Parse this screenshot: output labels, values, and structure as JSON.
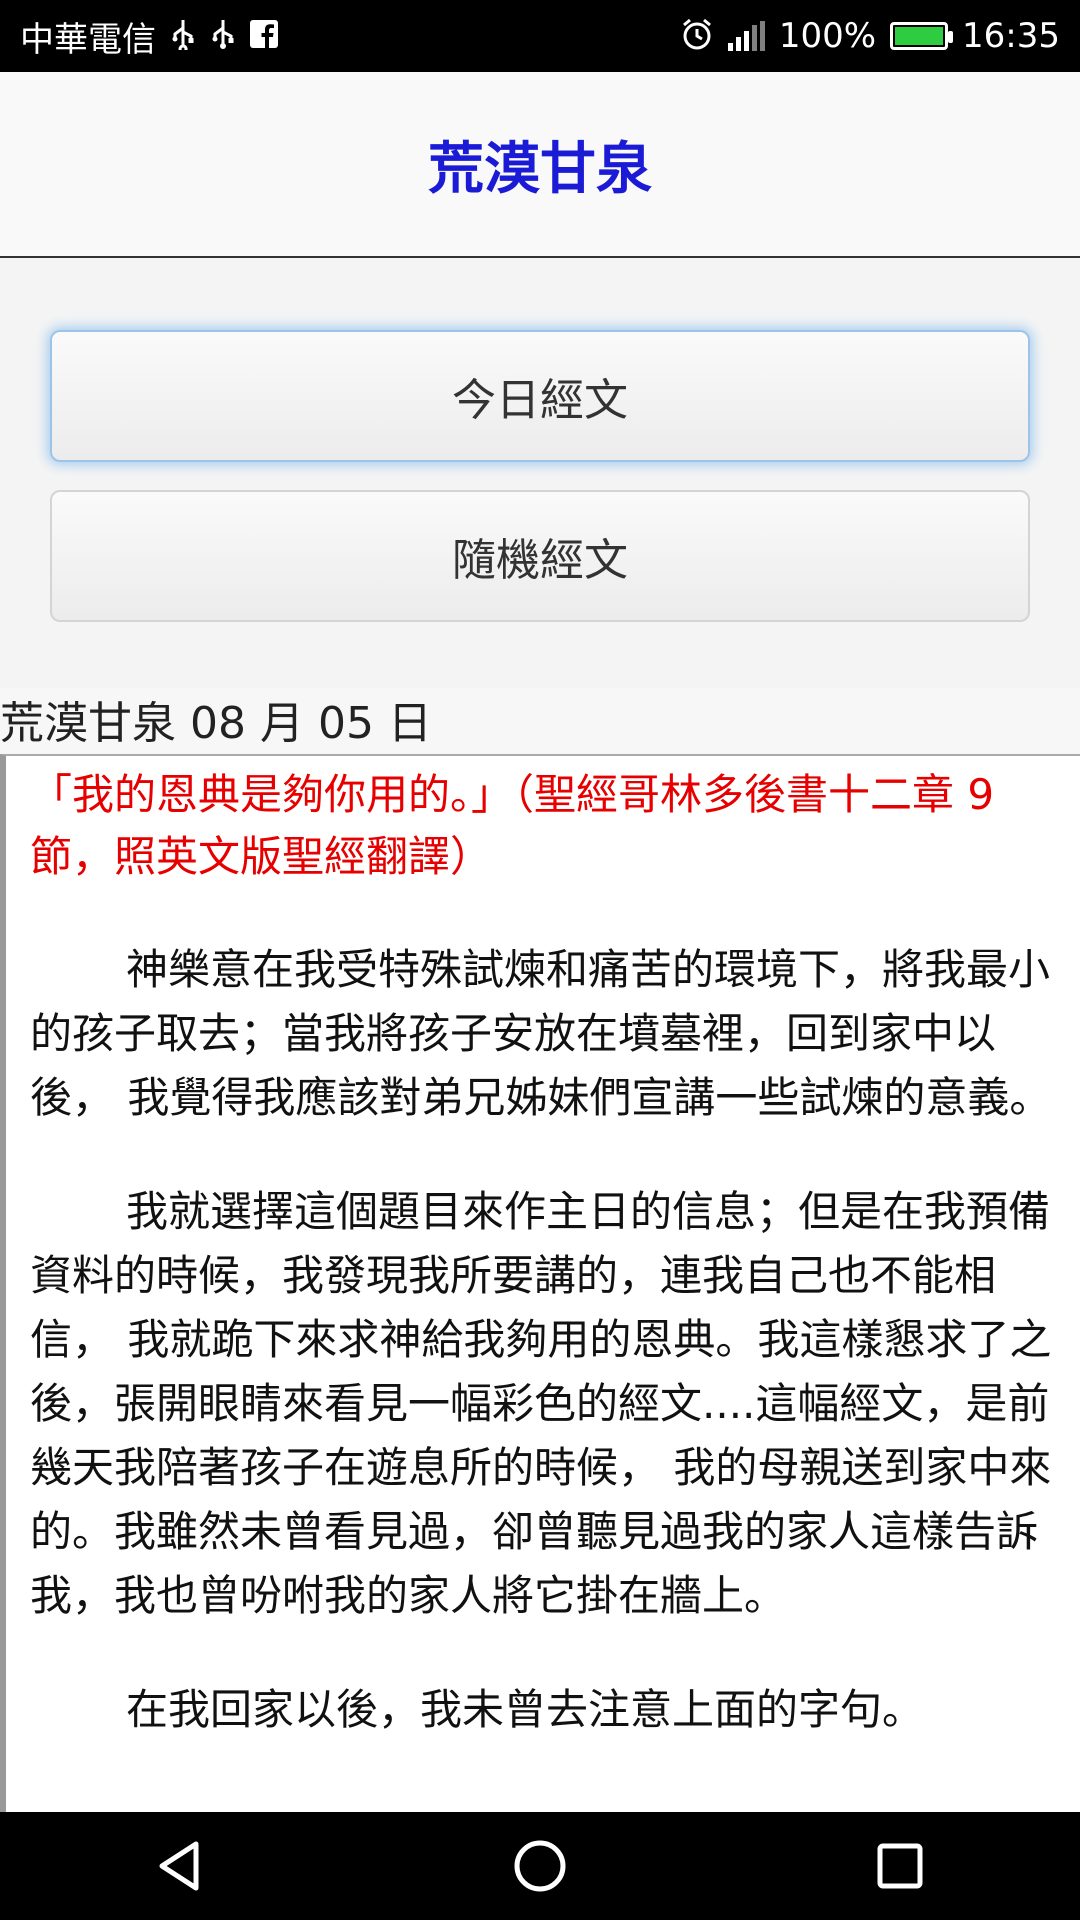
{
  "status_bar": {
    "carrier": "中華電信",
    "icons_left": [
      "usb-icon",
      "usb-icon",
      "facebook-icon"
    ],
    "battery_percent": "100%",
    "time": "16:35"
  },
  "header": {
    "title": "荒漠甘泉"
  },
  "buttons": {
    "today": "今日經文",
    "random": "隨機經文"
  },
  "date_line": "荒漠甘泉 08 月 05 日",
  "content": {
    "verse": "「我的恩典是夠你用的。」（聖經哥林多後書十二章 9 節，照英文版聖經翻譯）",
    "paragraphs": [
      "神樂意在我受特殊試煉和痛苦的環境下，將我最小的孩子取去；當我將孩子安放在墳墓裡，回到家中以後， 我覺得我應該對弟兄姊妹們宣講一些試煉的意義。",
      "我就選擇這個題目來作主日的信息；但是在我預備資料的時候，我發現我所要講的，連我自己也不能相信， 我就跪下來求神給我夠用的恩典。我這樣懇求了之後，張開眼睛來看見一幅彩色的經文....這幅經文，是前幾天我陪著孩子在遊息所的時候， 我的母親送到家中來的。我雖然未曾看見過，卻曾聽見過我的家人這樣告訴我，我也曾吩咐我的家人將它掛在牆上。",
      "在我回家以後，我未曾去注意上面的字句。"
    ]
  },
  "colors": {
    "title": "#1b1bd6",
    "verse": "#e60000",
    "battery_fill": "#2ecc40"
  }
}
